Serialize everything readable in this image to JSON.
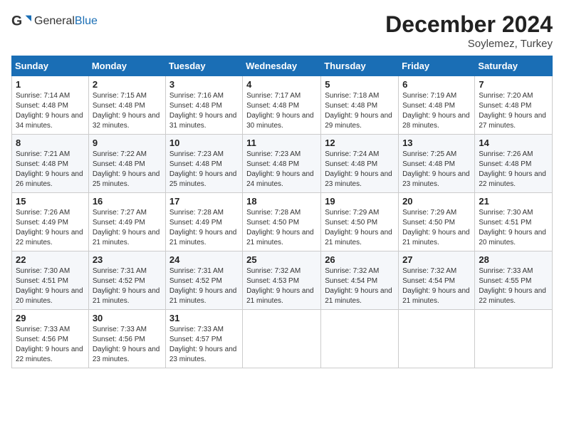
{
  "logo": {
    "general": "General",
    "blue": "Blue"
  },
  "header": {
    "month": "December 2024",
    "location": "Soylemez, Turkey"
  },
  "weekdays": [
    "Sunday",
    "Monday",
    "Tuesday",
    "Wednesday",
    "Thursday",
    "Friday",
    "Saturday"
  ],
  "weeks": [
    [
      {
        "day": 1,
        "sunrise": "7:14 AM",
        "sunset": "4:48 PM",
        "daylight": "9 hours and 34 minutes."
      },
      {
        "day": 2,
        "sunrise": "7:15 AM",
        "sunset": "4:48 PM",
        "daylight": "9 hours and 32 minutes."
      },
      {
        "day": 3,
        "sunrise": "7:16 AM",
        "sunset": "4:48 PM",
        "daylight": "9 hours and 31 minutes."
      },
      {
        "day": 4,
        "sunrise": "7:17 AM",
        "sunset": "4:48 PM",
        "daylight": "9 hours and 30 minutes."
      },
      {
        "day": 5,
        "sunrise": "7:18 AM",
        "sunset": "4:48 PM",
        "daylight": "9 hours and 29 minutes."
      },
      {
        "day": 6,
        "sunrise": "7:19 AM",
        "sunset": "4:48 PM",
        "daylight": "9 hours and 28 minutes."
      },
      {
        "day": 7,
        "sunrise": "7:20 AM",
        "sunset": "4:48 PM",
        "daylight": "9 hours and 27 minutes."
      }
    ],
    [
      {
        "day": 8,
        "sunrise": "7:21 AM",
        "sunset": "4:48 PM",
        "daylight": "9 hours and 26 minutes."
      },
      {
        "day": 9,
        "sunrise": "7:22 AM",
        "sunset": "4:48 PM",
        "daylight": "9 hours and 25 minutes."
      },
      {
        "day": 10,
        "sunrise": "7:23 AM",
        "sunset": "4:48 PM",
        "daylight": "9 hours and 25 minutes."
      },
      {
        "day": 11,
        "sunrise": "7:23 AM",
        "sunset": "4:48 PM",
        "daylight": "9 hours and 24 minutes."
      },
      {
        "day": 12,
        "sunrise": "7:24 AM",
        "sunset": "4:48 PM",
        "daylight": "9 hours and 23 minutes."
      },
      {
        "day": 13,
        "sunrise": "7:25 AM",
        "sunset": "4:48 PM",
        "daylight": "9 hours and 23 minutes."
      },
      {
        "day": 14,
        "sunrise": "7:26 AM",
        "sunset": "4:48 PM",
        "daylight": "9 hours and 22 minutes."
      }
    ],
    [
      {
        "day": 15,
        "sunrise": "7:26 AM",
        "sunset": "4:49 PM",
        "daylight": "9 hours and 22 minutes."
      },
      {
        "day": 16,
        "sunrise": "7:27 AM",
        "sunset": "4:49 PM",
        "daylight": "9 hours and 21 minutes."
      },
      {
        "day": 17,
        "sunrise": "7:28 AM",
        "sunset": "4:49 PM",
        "daylight": "9 hours and 21 minutes."
      },
      {
        "day": 18,
        "sunrise": "7:28 AM",
        "sunset": "4:50 PM",
        "daylight": "9 hours and 21 minutes."
      },
      {
        "day": 19,
        "sunrise": "7:29 AM",
        "sunset": "4:50 PM",
        "daylight": "9 hours and 21 minutes."
      },
      {
        "day": 20,
        "sunrise": "7:29 AM",
        "sunset": "4:50 PM",
        "daylight": "9 hours and 21 minutes."
      },
      {
        "day": 21,
        "sunrise": "7:30 AM",
        "sunset": "4:51 PM",
        "daylight": "9 hours and 20 minutes."
      }
    ],
    [
      {
        "day": 22,
        "sunrise": "7:30 AM",
        "sunset": "4:51 PM",
        "daylight": "9 hours and 20 minutes."
      },
      {
        "day": 23,
        "sunrise": "7:31 AM",
        "sunset": "4:52 PM",
        "daylight": "9 hours and 21 minutes."
      },
      {
        "day": 24,
        "sunrise": "7:31 AM",
        "sunset": "4:52 PM",
        "daylight": "9 hours and 21 minutes."
      },
      {
        "day": 25,
        "sunrise": "7:32 AM",
        "sunset": "4:53 PM",
        "daylight": "9 hours and 21 minutes."
      },
      {
        "day": 26,
        "sunrise": "7:32 AM",
        "sunset": "4:54 PM",
        "daylight": "9 hours and 21 minutes."
      },
      {
        "day": 27,
        "sunrise": "7:32 AM",
        "sunset": "4:54 PM",
        "daylight": "9 hours and 21 minutes."
      },
      {
        "day": 28,
        "sunrise": "7:33 AM",
        "sunset": "4:55 PM",
        "daylight": "9 hours and 22 minutes."
      }
    ],
    [
      {
        "day": 29,
        "sunrise": "7:33 AM",
        "sunset": "4:56 PM",
        "daylight": "9 hours and 22 minutes."
      },
      {
        "day": 30,
        "sunrise": "7:33 AM",
        "sunset": "4:56 PM",
        "daylight": "9 hours and 23 minutes."
      },
      {
        "day": 31,
        "sunrise": "7:33 AM",
        "sunset": "4:57 PM",
        "daylight": "9 hours and 23 minutes."
      },
      null,
      null,
      null,
      null
    ]
  ],
  "labels": {
    "sunrise": "Sunrise:",
    "sunset": "Sunset:",
    "daylight": "Daylight:"
  }
}
